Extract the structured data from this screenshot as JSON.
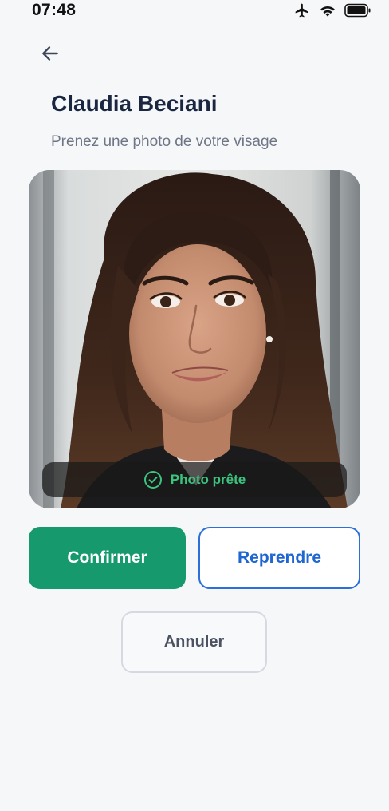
{
  "status_bar": {
    "time": "07:48",
    "icons": [
      "airplane-icon",
      "wifi-icon",
      "battery-icon"
    ]
  },
  "header": {
    "back_icon": "arrow-left-icon",
    "title": "Claudia Beciani",
    "subtitle": "Prenez une photo de votre visage"
  },
  "photo": {
    "status_icon": "check-circle-icon",
    "status_label": "Photo prête",
    "status_color": "#3cc47f"
  },
  "actions": {
    "confirm_label": "Confirmer",
    "retake_label": "Reprendre",
    "cancel_label": "Annuler"
  },
  "colors": {
    "background": "#f6f7f9",
    "primary_green": "#169a6d",
    "accent_blue": "#2c6fd9",
    "title": "#1b2740",
    "subtitle": "#6e7585"
  }
}
